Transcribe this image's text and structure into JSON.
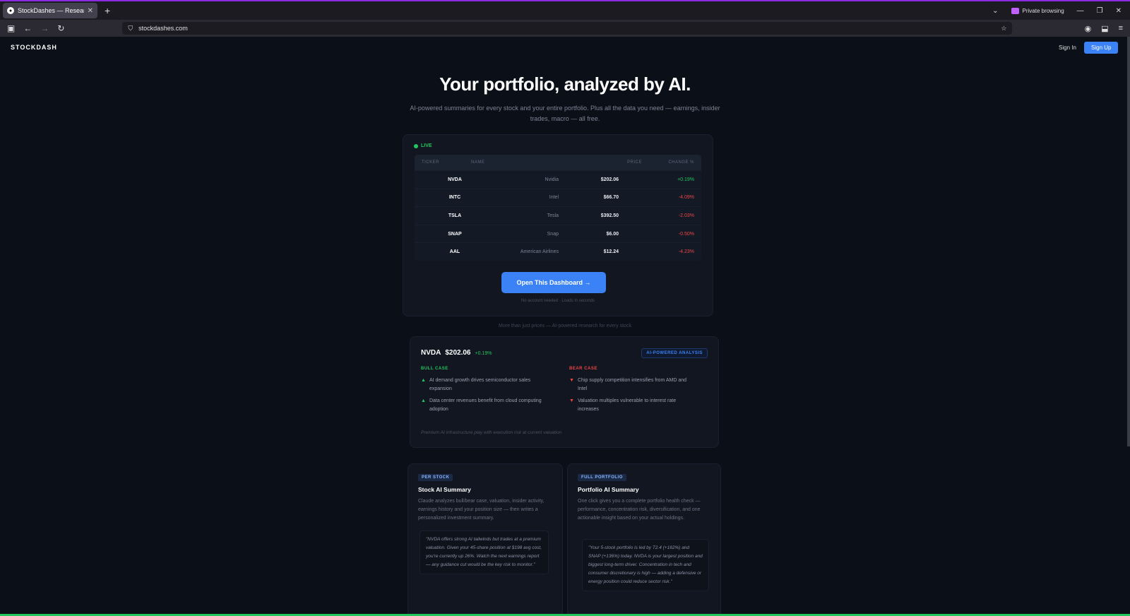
{
  "browser": {
    "tab_title": "StockDashes — Research your st...",
    "tab_close": "✕",
    "new_tab": "+",
    "private_label": "Private browsing",
    "url": "stockdashes.com"
  },
  "header": {
    "logo": "STOCKDASH",
    "signin": "Sign In",
    "signup": "Sign Up"
  },
  "hero": {
    "title": "Your portfolio, analyzed by AI.",
    "subtitle": "AI-powered summaries for every stock and your entire portfolio. Plus all the data you need — earnings, insider trades, macro — all free."
  },
  "live_table": {
    "live_label": "LIVE",
    "headers": {
      "ticker": "TICKER",
      "name": "NAME",
      "price": "PRICE",
      "change": "CHANGE %"
    },
    "rows": [
      {
        "ticker": "NVDA",
        "name": "Nvidia",
        "price": "$202.06",
        "change": "+0.19%",
        "dir": "up"
      },
      {
        "ticker": "INTC",
        "name": "Intel",
        "price": "$66.70",
        "change": "-4.09%",
        "dir": "down"
      },
      {
        "ticker": "TSLA",
        "name": "Tesla",
        "price": "$392.50",
        "change": "-2.03%",
        "dir": "down"
      },
      {
        "ticker": "SNAP",
        "name": "Snap",
        "price": "$6.00",
        "change": "-0.50%",
        "dir": "down"
      },
      {
        "ticker": "AAL",
        "name": "American Airlines",
        "price": "$12.24",
        "change": "-4.23%",
        "dir": "down"
      }
    ],
    "cta": "Open This Dashboard →",
    "note": "No account needed · Loads in seconds"
  },
  "between_text": "More than just prices — AI-powered research for every stock",
  "analysis": {
    "ticker": "NVDA",
    "price": "$202.06",
    "change": "+0.19%",
    "badge": "AI-POWERED ANALYSIS",
    "bull_title": "BULL CASE",
    "bear_title": "BEAR CASE",
    "bull": [
      "AI demand growth drives semiconductor sales expansion",
      "Data center revenues benefit from cloud computing adoption"
    ],
    "bear": [
      "Chip supply competition intensifies from AMD and Intel",
      "Valuation multiples vulnerable to interest rate increases"
    ],
    "bull_icon": "▲",
    "bear_icon": "▼",
    "verdict": "Premium AI infrastructure play with execution risk at current valuation"
  },
  "features": [
    {
      "badge": "PER STOCK",
      "title": "Stock AI Summary",
      "desc": "Claude analyzes bull/bear case, valuation, insider activity, earnings history and your position size — then writes a personalized investment summary.",
      "quote": "\"NVDA offers strong AI tailwinds but trades at a premium valuation. Given your 45-share position at $198 avg cost, you're currently up 26%. Watch the next earnings report — any guidance cut would be the key risk to monitor.\""
    },
    {
      "badge": "FULL PORTFOLIO",
      "title": "Portfolio AI Summary",
      "desc": "One click gives you a complete portfolio health check — performance, concentration risk, diversification, and one actionable insight based on your actual holdings.",
      "quote": "\"Your 5-stock portfolio is led by T2.4 (+162%) and SNAP (+136%) today. NVDA is your largest position and biggest long-term driver. Concentration in tech and consumer discretionary is high — adding a defensive or energy position could reduce sector risk.\""
    }
  ]
}
